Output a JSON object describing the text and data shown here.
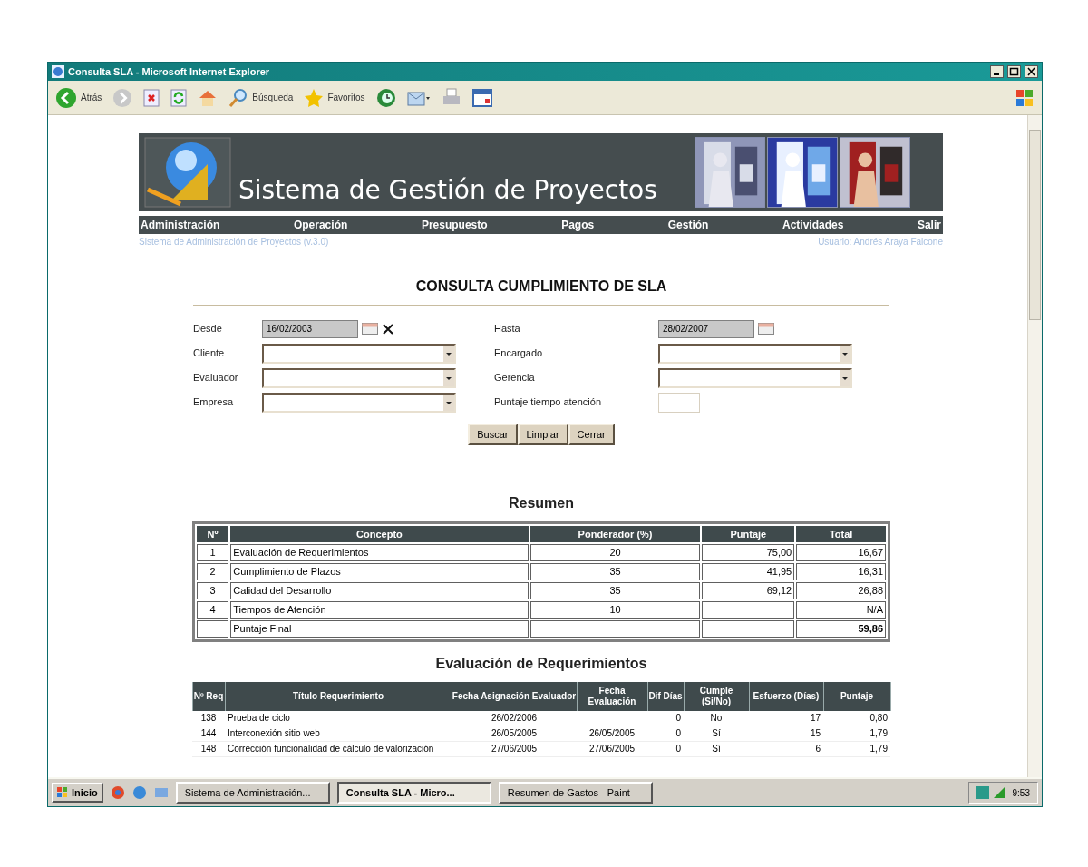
{
  "window": {
    "title": "Consulta SLA - Microsoft Internet Explorer"
  },
  "toolbar": [
    {
      "kind": "back",
      "label": "Atrás"
    },
    {
      "kind": "forward"
    },
    {
      "kind": "stop"
    },
    {
      "kind": "refresh"
    },
    {
      "kind": "home"
    },
    {
      "kind": "search",
      "label": "Búsqueda"
    },
    {
      "kind": "favorites",
      "label": "Favoritos"
    },
    {
      "kind": "history"
    },
    {
      "kind": "mail"
    },
    {
      "kind": "print"
    },
    {
      "kind": "edit"
    }
  ],
  "banner": {
    "title": "Sistema de Gestión de Proyectos"
  },
  "menu": [
    "Administración",
    "Operación",
    "Presupuesto",
    "Pagos",
    "Gestión",
    "Actividades",
    "Salir"
  ],
  "subheader": {
    "system": "Sistema de Administración de Proyectos (v.3.0)",
    "user": "Usuario: Andrés Araya Falcone"
  },
  "page_title": "CONSULTA CUMPLIMIENTO DE SLA",
  "form": {
    "left": [
      {
        "kind": "date",
        "label": "Desde",
        "value": "16/02/2003",
        "clear": true
      },
      {
        "kind": "select",
        "label": "Cliente"
      },
      {
        "kind": "select",
        "label": "Evaluador"
      },
      {
        "kind": "select",
        "label": "Empresa"
      }
    ],
    "right": [
      {
        "kind": "date",
        "label": "Hasta",
        "value": "28/02/2007",
        "clear": false
      },
      {
        "kind": "select",
        "label": "Encargado"
      },
      {
        "kind": "select",
        "label": "Gerencia"
      },
      {
        "kind": "text",
        "label": "Puntaje tiempo atención"
      }
    ]
  },
  "buttons": [
    "Buscar",
    "Limpiar",
    "Cerrar"
  ],
  "summary": {
    "title": "Resumen",
    "columns": [
      "Nº",
      "Concepto",
      "Ponderador (%)",
      "Puntaje",
      "Total"
    ],
    "rows": [
      [
        "1",
        "Evaluación de Requerimientos",
        "20",
        "75,00",
        "16,67"
      ],
      [
        "2",
        "Cumplimiento de Plazos",
        "35",
        "41,95",
        "16,31"
      ],
      [
        "3",
        "Calidad del Desarrollo",
        "35",
        "69,12",
        "26,88"
      ],
      [
        "4",
        "Tiempos de Atención",
        "10",
        "",
        "N/A"
      ],
      [
        "",
        "Puntaje Final",
        "",
        "",
        "59,86"
      ]
    ]
  },
  "requirements": {
    "title": "Evaluación de Requerimientos",
    "columns": [
      "Nº Req",
      "Título Requerimiento",
      "Fecha Asignación Evaluador",
      "Fecha Evaluación",
      "Dif Días",
      "Cumple (Si/No)",
      "Esfuerzo (Días)",
      "Puntaje"
    ],
    "rows": [
      [
        "138",
        "Prueba de ciclo",
        "26/02/2006",
        "",
        "0",
        "No",
        "17",
        "0,80"
      ],
      [
        "144",
        "Interconexión sitio web",
        "26/05/2005",
        "26/05/2005",
        "0",
        "Sí",
        "15",
        "1,79"
      ],
      [
        "148",
        "Corrección funcionalidad de cálculo de valorización",
        "27/06/2005",
        "27/06/2005",
        "0",
        "Sí",
        "6",
        "1,79"
      ]
    ]
  },
  "taskbar": {
    "start": "Inicio",
    "tasks": [
      {
        "label": "Sistema de Administración...",
        "selected": false
      },
      {
        "label": "Consulta SLA - Micro...",
        "selected": true
      },
      {
        "label": "Resumen de Gastos - Paint",
        "selected": false
      }
    ],
    "clock": "9:53"
  }
}
